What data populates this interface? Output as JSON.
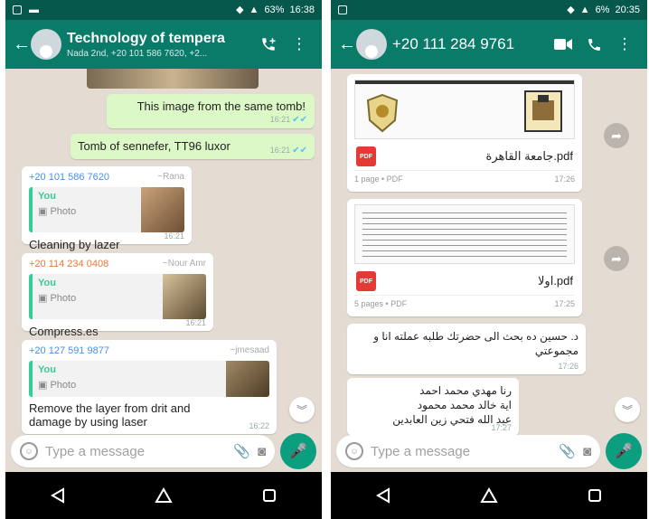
{
  "left": {
    "status": {
      "battery": "63%",
      "time": "16:38"
    },
    "header": {
      "title": "Technology of tempera",
      "subtitle": "Nada 2nd, +20 101 586 7620, +2..."
    },
    "messages": [
      {
        "text": "This image from the same tomb!",
        "time": "16:21"
      },
      {
        "text": "Tomb of sennefer, TT96 luxor",
        "time": "16:21"
      },
      {
        "sender": "+20 101 586 7620",
        "push": "~Rana",
        "quote_name": "You",
        "quote_type": "Photo",
        "text": "Cleaning by lazer",
        "time": "16:21"
      },
      {
        "sender": "+20 114 234 0408",
        "push": "~Nour Amr",
        "quote_name": "You",
        "quote_type": "Photo",
        "text": "Compress.es",
        "time": "16:21"
      },
      {
        "sender": "+20 127 591 9877",
        "push": "~jmesaad",
        "quote_name": "You",
        "quote_type": "Photo",
        "text": "Remove the layer from drit and damage by using laser",
        "time": "16:22"
      }
    ],
    "composer": {
      "placeholder": "Type a message"
    },
    "colors": {
      "appbar": "#0a7a69",
      "statusbar": "#06584d",
      "outgoing": "#dcf8c6",
      "accent": "#0b9e7f"
    }
  },
  "right": {
    "status": {
      "battery": "6%",
      "time": "20:35"
    },
    "header": {
      "title": "+20 111 284 9761"
    },
    "messages": [
      {
        "type": "pdf",
        "filename": "جامعة القاهرة.pdf",
        "meta": "1 page • PDF",
        "time": "17:26"
      },
      {
        "type": "pdf",
        "filename": "اولا.pdf",
        "meta": "5 pages • PDF",
        "time": "17:25"
      },
      {
        "text": "د. حسين ده بحث الى حضرتك طلبه عملته انا و مجموعتي",
        "time": "17:26"
      },
      {
        "text": "رنا مهدي محمد احمد\nاية خالد محمد محمود\nعبد الله فتحي زين العابدين",
        "time": "17:27"
      }
    ],
    "composer": {
      "placeholder": "Type a message"
    }
  }
}
